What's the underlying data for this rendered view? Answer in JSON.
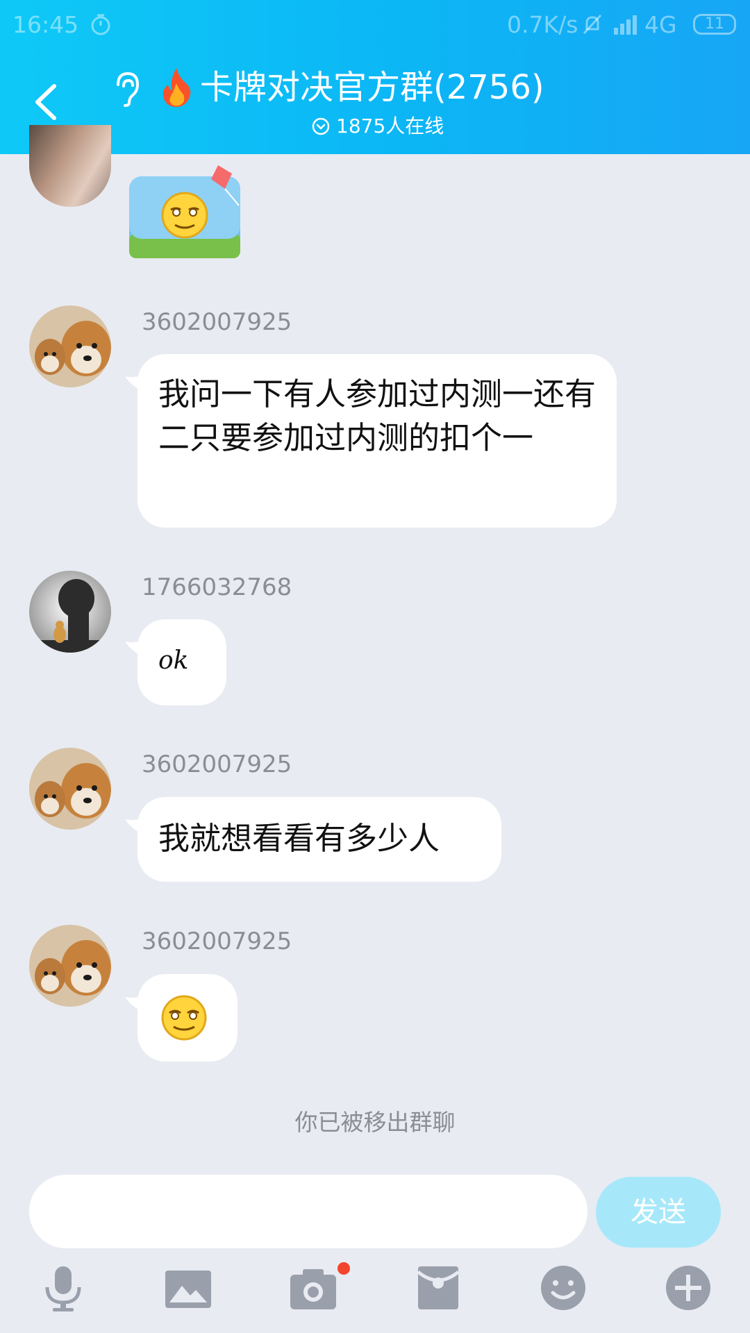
{
  "status_bar": {
    "time": "16:45",
    "network_speed": "0.7K/s",
    "network_type": "4G",
    "battery": "11"
  },
  "header": {
    "title": "卡牌对决官方群(2756)",
    "online": "1875人在线"
  },
  "messages": [
    {
      "sender": "3602007925",
      "text": "我问一下有人参加过内测一还有二只要参加过内测的扣个一"
    },
    {
      "sender": "1766032768",
      "text": "ok"
    },
    {
      "sender": "3602007925",
      "text": "我就想看看有多少人"
    },
    {
      "sender": "3602007925",
      "text": ""
    }
  ],
  "system_message": "你已被移出群聊",
  "input": {
    "placeholder": "",
    "send_label": "发送"
  },
  "toolbar": [
    "mic-icon",
    "image-icon",
    "camera-icon",
    "red-packet-icon",
    "emoji-icon",
    "plus-icon"
  ],
  "colors": {
    "header": "#0cb6f5",
    "background": "#e9ebf2",
    "send_button": "#a6e8fa",
    "toolbar_icon": "#9aa0ab"
  }
}
